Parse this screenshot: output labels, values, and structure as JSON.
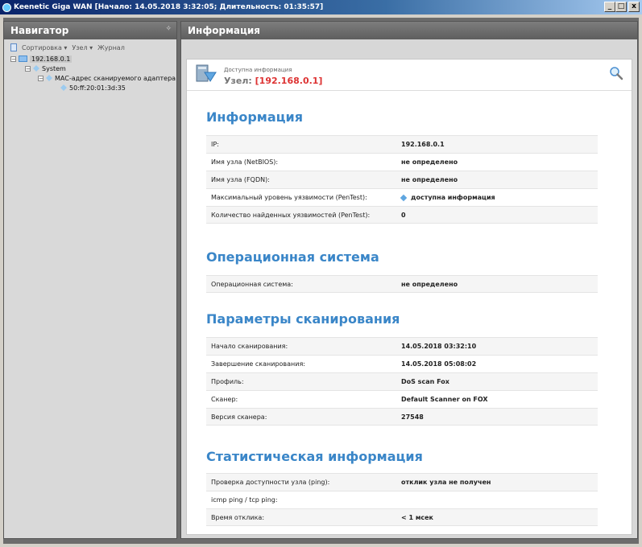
{
  "window": {
    "title": "Keenetic Giga WAN [Начало: 14.05.2018 3:32:05; Длительность: 01:35:57]",
    "minimize_label": "_",
    "maximize_label": "□",
    "close_label": "x"
  },
  "navigator": {
    "title": "Навигатор",
    "toolbar": {
      "sort": "Сортировка ▾",
      "node": "Узел ▾",
      "journal": "Журнал"
    },
    "tree": {
      "root": "192.168.0.1",
      "system": "System",
      "mac_group": "MAC-адрес сканируемого адаптера",
      "mac_value": "50:ff:20:01:3d:35"
    }
  },
  "main": {
    "title": "Информация",
    "header": {
      "small": "Доступна информация",
      "node_prefix": "Узел:",
      "node_ip": "[192.168.0.1]"
    },
    "sections": {
      "info": {
        "title": "Информация",
        "rows": [
          {
            "label": "IP:",
            "value": "192.168.0.1"
          },
          {
            "label": "Имя узла (NetBIOS):",
            "value": "не определено"
          },
          {
            "label": "Имя узла (FQDN):",
            "value": "не определено"
          },
          {
            "label": "Максимальный уровень уязвимости (PenTest):",
            "value": "доступна информация"
          },
          {
            "label": "Количество найденных уязвимостей (PenTest):",
            "value": "0"
          }
        ]
      },
      "os": {
        "title": "Операционная система",
        "rows": [
          {
            "label": "Операционная система:",
            "value": "не определено"
          }
        ]
      },
      "scan": {
        "title": "Параметры сканирования",
        "rows": [
          {
            "label": "Начало сканирования:",
            "value": "14.05.2018 03:32:10"
          },
          {
            "label": "Завершение сканирования:",
            "value": "14.05.2018 05:08:02"
          },
          {
            "label": "Профиль:",
            "value": "DoS scan Fox"
          },
          {
            "label": "Сканер:",
            "value": "Default Scanner on FOX"
          },
          {
            "label": "Версия сканера:",
            "value": "27548"
          }
        ]
      },
      "stats": {
        "title": "Статистическая информация",
        "rows": [
          {
            "label": "Проверка доступности узла (ping):",
            "value": "отклик узла не получен"
          },
          {
            "label": "icmp ping / tcp ping:",
            "value": ""
          },
          {
            "label": "Время отклика:",
            "value": "< 1 мсек"
          }
        ]
      }
    }
  },
  "colors": {
    "title_bar": "#0a246a",
    "panel_header": "#6a6a6a",
    "section_title": "#3a86c8",
    "node_ip": "#dd3333"
  },
  "icons": [
    "app-icon",
    "folder-icon",
    "monitor-icon",
    "zoom-icon",
    "info-diamond-icon"
  ]
}
